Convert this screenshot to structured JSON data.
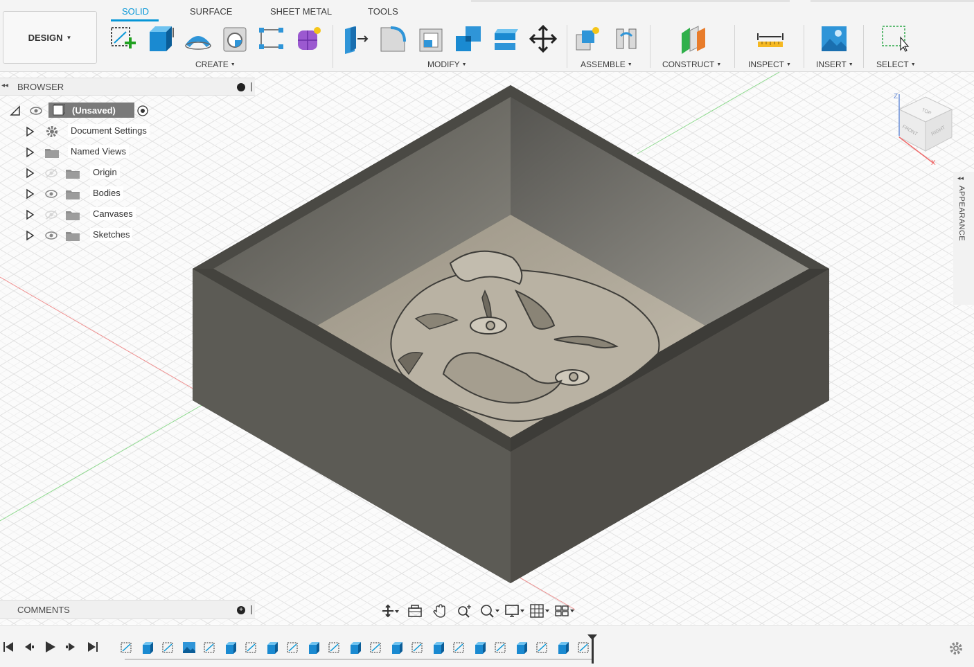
{
  "tabs": [
    {
      "label": "SOLID",
      "active": true
    },
    {
      "label": "SURFACE",
      "active": false
    },
    {
      "label": "SHEET METAL",
      "active": false
    },
    {
      "label": "TOOLS",
      "active": false
    }
  ],
  "workspace": {
    "label": "DESIGN"
  },
  "toolbar_groups": {
    "create": "CREATE",
    "modify": "MODIFY",
    "assemble": "ASSEMBLE",
    "construct": "CONSTRUCT",
    "inspect": "INSPECT",
    "insert": "INSERT",
    "select": "SELECT"
  },
  "browser": {
    "title": "BROWSER",
    "root": "(Unsaved)",
    "items": [
      {
        "label": "Document Settings",
        "icon": "gear-icon"
      },
      {
        "label": "Named Views",
        "icon": "folder-icon"
      },
      {
        "label": "Origin",
        "icon": "folder-icon",
        "visibility": "hidden"
      },
      {
        "label": "Bodies",
        "icon": "folder-icon",
        "visibility": "visible"
      },
      {
        "label": "Canvases",
        "icon": "folder-icon",
        "visibility": "hidden"
      },
      {
        "label": "Sketches",
        "icon": "folder-icon",
        "visibility": "visible"
      }
    ]
  },
  "comments": {
    "title": "COMMENTS"
  },
  "appearance": {
    "label": "APPEARANCE"
  },
  "viewcube": {
    "top": "TOP",
    "front": "FRONT",
    "right": "RIGHT",
    "z": "Z",
    "x": "X"
  },
  "colors": {
    "accent": "#0696d7",
    "model_dark": "#5e5c55",
    "model_floor": "#b3ab9c"
  },
  "timeline": {
    "feature_count": 23
  }
}
